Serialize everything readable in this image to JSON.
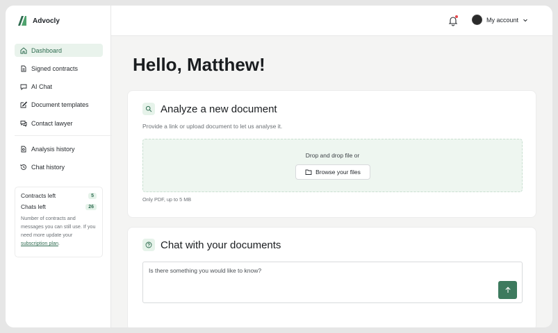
{
  "brand": {
    "name": "Advocly",
    "color": "#2e6b50"
  },
  "sidebar": {
    "items": [
      {
        "label": "Dashboard",
        "icon": "home-icon",
        "active": true
      },
      {
        "label": "Signed contracts",
        "icon": "document-icon"
      },
      {
        "label": "AI Chat",
        "icon": "chat-bubble-icon"
      },
      {
        "label": "Document templates",
        "icon": "edit-icon"
      },
      {
        "label": "Contact lawyer",
        "icon": "chat-lawyer-icon"
      }
    ],
    "secondary_items": [
      {
        "label": "Analysis history",
        "icon": "document-search-icon"
      },
      {
        "label": "Chat history",
        "icon": "history-icon"
      }
    ],
    "quota": {
      "contracts_label": "Contracts left",
      "contracts_value": "5",
      "chats_label": "Chats left",
      "chats_value": "26",
      "note": "Number of contracts and messages you can still use. If you need more update your",
      "link": "subscription plan",
      "note_end": "."
    }
  },
  "header": {
    "account_label": "My account",
    "notification_dot_color": "#e5484d"
  },
  "main": {
    "greeting": "Hello, Matthew!",
    "analyze": {
      "title": "Analyze a new document",
      "subtitle": "Provide a link or upload document to let us analyse it.",
      "drop_text": "Drop and drop file or",
      "browse_label": "Browse your files",
      "hint": "Only PDF, up to 5 MB"
    },
    "chat": {
      "title": "Chat with your documents",
      "placeholder": "Is there something you would like to know?"
    }
  },
  "colors": {
    "accent": "#3d7a5e",
    "accent_light": "#e6f3ea"
  }
}
